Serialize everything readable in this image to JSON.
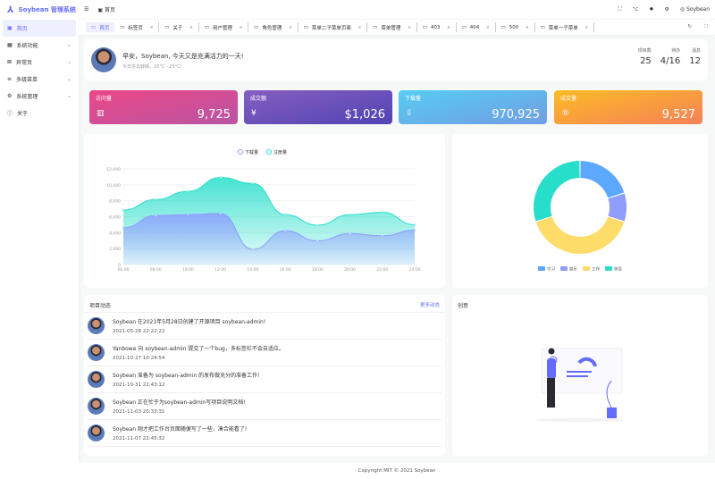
{
  "app": {
    "title": "Soybean 管理系统"
  },
  "sidebar": {
    "items": [
      {
        "label": "首页",
        "icon": "dashboard-icon",
        "active": true
      },
      {
        "label": "系统功能",
        "icon": "grid-icon",
        "expandable": true
      },
      {
        "label": "异常页",
        "icon": "exception-icon",
        "expandable": true
      },
      {
        "label": "多级菜单",
        "icon": "menu-icon",
        "expandable": true
      },
      {
        "label": "系统管理",
        "icon": "settings-icon",
        "expandable": true
      },
      {
        "label": "关于",
        "icon": "info-icon"
      }
    ]
  },
  "header": {
    "breadcrumb": "首页",
    "user": "Soybean"
  },
  "tabs": [
    {
      "label": "首页",
      "active": true
    },
    {
      "label": "标签页"
    },
    {
      "label": "关于"
    },
    {
      "label": "用户管理"
    },
    {
      "label": "角色管理"
    },
    {
      "label": "菜单二子菜单页面"
    },
    {
      "label": "菜单管理"
    },
    {
      "label": "403"
    },
    {
      "label": "404"
    },
    {
      "label": "500"
    },
    {
      "label": "菜单一子菜单"
    }
  ],
  "greeting": {
    "title": "早安，Soybean, 今天又是充满活力的一天!",
    "weather": "今日多云转晴，20°C - 25°C!",
    "stats": [
      {
        "label": "项目数",
        "value": "25"
      },
      {
        "label": "待办",
        "value": "4/16"
      },
      {
        "label": "消息",
        "value": "12"
      }
    ]
  },
  "cards": [
    {
      "label": "访问量",
      "value": "9,725",
      "icon": "bar-chart-icon",
      "from": "#ec4786",
      "to": "#b955a4"
    },
    {
      "label": "成交额",
      "value": "$1,026",
      "icon": "money-icon",
      "from": "#865ec0",
      "to": "#5144b4"
    },
    {
      "label": "下载量",
      "value": "970,925",
      "icon": "download-icon",
      "from": "#56cdf3",
      "to": "#719de3"
    },
    {
      "label": "成交量",
      "value": "9,527",
      "icon": "registered-icon",
      "from": "#fcbc25",
      "to": "#f68057"
    }
  ],
  "chart_data": [
    {
      "type": "area",
      "stacked": true,
      "x": [
        "06:00",
        "08:00",
        "10:00",
        "12:00",
        "14:00",
        "16:00",
        "18:00",
        "20:00",
        "22:00",
        "24:00"
      ],
      "series": [
        {
          "name": "下载量",
          "values": [
            4623,
            6145,
            6268,
            6411,
            1890,
            4251,
            2978,
            3880,
            3606,
            4311
          ],
          "color": "#8e9dff"
        },
        {
          "name": "注册量",
          "values": [
            2208,
            2016,
            2916,
            4512,
            8281,
            2008,
            1963,
            2367,
            2956,
            678
          ],
          "color": "#26deca"
        }
      ],
      "yticks": [
        "0",
        "2,000",
        "4,000",
        "6,000",
        "8,000",
        "10,000",
        "12,000"
      ],
      "ylim": [
        0,
        12000
      ],
      "legend": "top",
      "grid": true
    },
    {
      "type": "pie",
      "donut": true,
      "categories": [
        "学习",
        "娱乐",
        "工作",
        "休息"
      ],
      "values": [
        20,
        10,
        40,
        30
      ],
      "colors": [
        "#5da8ff",
        "#8e9dff",
        "#fedc69",
        "#26deca"
      ],
      "legend": "bottom"
    }
  ],
  "activity": {
    "title": "项目动态",
    "more": "更多动态",
    "items": [
      {
        "text": "Soybean 在2021年5月28日创建了开源项目 soybean-admin!",
        "time": "2021-05-28 22:22:22"
      },
      {
        "text": "Yanbowe 向 soybean-admin 提交了一个bug，多标签栏不会自适应。",
        "time": "2021-10-27 10:24:54"
      },
      {
        "text": "Soybean 准备为 soybean-admin 的发布做充分的准备工作!",
        "time": "2021-10-31 22:43:12"
      },
      {
        "text": "Soybean 正在忙于为soybean-admin写项目说明文档!",
        "time": "2021-11-03 20:33:31"
      },
      {
        "text": "Soybean 刚才把工作台页面随便写了一些，凑合能看了!",
        "time": "2021-11-07 22:45:32"
      }
    ]
  },
  "creativity": {
    "title": "创意"
  },
  "footer": "Copyright MIT © 2021 Soybean"
}
